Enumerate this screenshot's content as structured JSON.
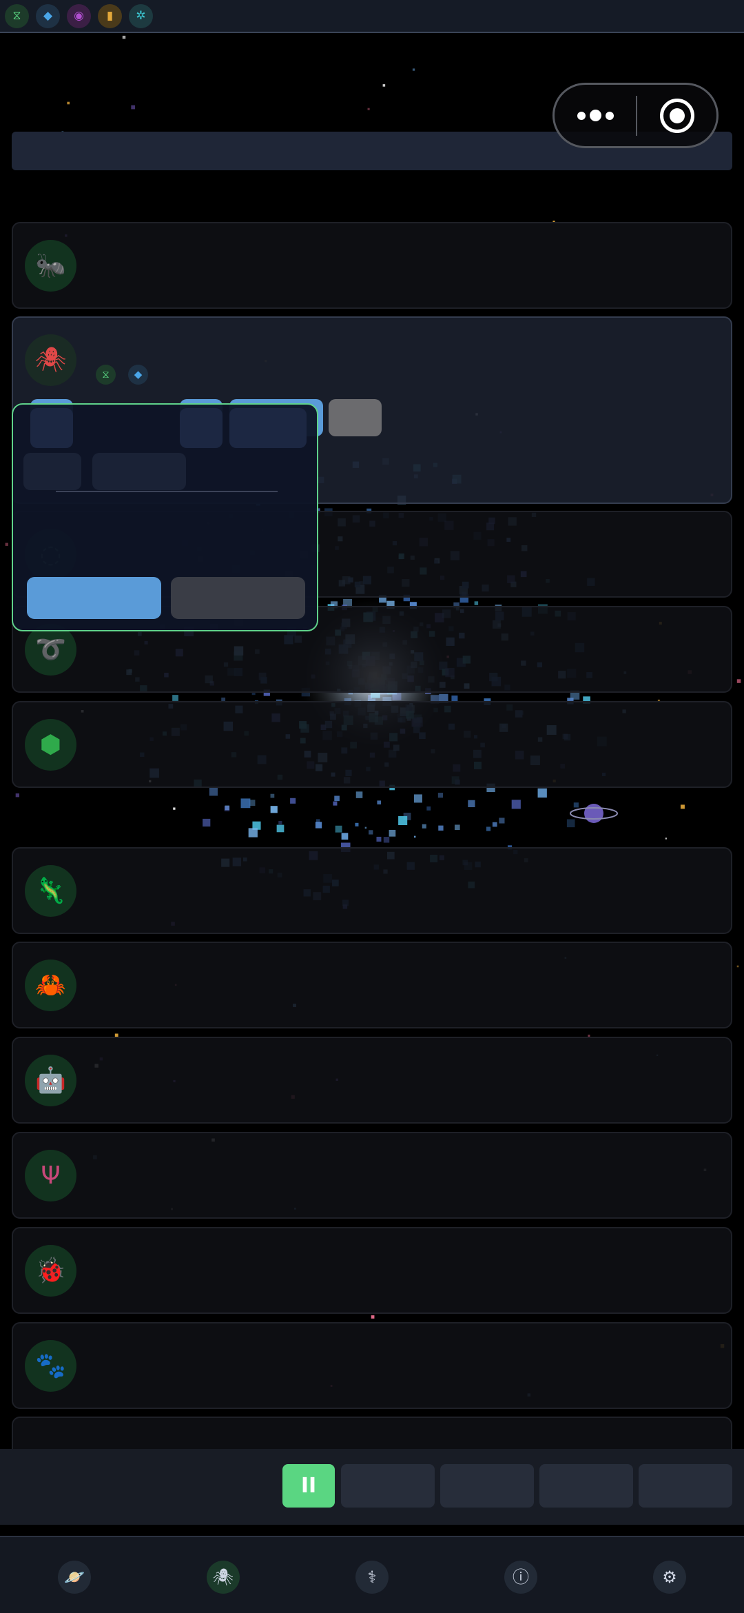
{
  "topbar": {
    "resources": [
      {
        "icon": "dna-icon",
        "glyph": "⧖",
        "bg": "#1d3b2a",
        "color": "#5ad682"
      },
      {
        "icon": "gem-icon",
        "glyph": "◆",
        "bg": "#1e3144",
        "color": "#4aa6e8"
      },
      {
        "icon": "orb-icon",
        "glyph": "◉",
        "bg": "#3b1f45",
        "color": "#b14fd0"
      },
      {
        "icon": "energy-icon",
        "glyph": "▮",
        "bg": "#4a3a1a",
        "color": "#e3a83a"
      },
      {
        "icon": "gear-icon",
        "glyph": "✲",
        "bg": "#1d3a40",
        "color": "#3cc7d2"
      }
    ]
  },
  "creatures": [
    {
      "name": "ant-icon",
      "glyph": "🐜",
      "color": "#3fb85f"
    },
    {
      "name": "spider-icon",
      "glyph": "🕷",
      "color": "#e04848"
    },
    {
      "name": "creature-3-icon",
      "glyph": "◌",
      "color": "#3f8f6a"
    },
    {
      "name": "ring-creature-icon",
      "glyph": "➰",
      "color": "#b6c23a"
    },
    {
      "name": "hexagon-icon",
      "glyph": "⬢",
      "color": "#2faa4b"
    },
    {
      "name": "lizard-icon",
      "glyph": "🦎",
      "color": "#5a7ad8"
    },
    {
      "name": "crab-icon",
      "glyph": "🦀",
      "color": "#a25a4a"
    },
    {
      "name": "robot-icon",
      "glyph": "🤖",
      "color": "#4d63c8"
    },
    {
      "name": "antenna-icon",
      "glyph": "Ψ",
      "color": "#c8487a"
    },
    {
      "name": "beetle-icon",
      "glyph": "🐞",
      "color": "#b0a050"
    },
    {
      "name": "beast-icon",
      "glyph": "🐾",
      "color": "#a03a3a"
    }
  ],
  "expanded_card": {
    "badges": [
      {
        "icon": "dna-icon",
        "glyph": "⧖",
        "bg": "#1d3b2a",
        "color": "#5ad682"
      },
      {
        "icon": "gem-icon",
        "glyph": "◆",
        "bg": "#1e3144",
        "color": "#4aa6e8"
      }
    ]
  },
  "controls": {
    "pause_label": "II"
  },
  "nav": [
    {
      "icon": "planet-icon",
      "glyph": "🪐"
    },
    {
      "icon": "spider-nav-icon",
      "glyph": "🕷"
    },
    {
      "icon": "dna-nav-icon",
      "glyph": "⚕"
    },
    {
      "icon": "info-icon",
      "glyph": "ⓘ"
    },
    {
      "icon": "settings-icon",
      "glyph": "⚙"
    }
  ],
  "colors": {
    "accent_green": "#5ad682",
    "accent_blue": "#5a9bd8",
    "popup_border": "#5fd28a"
  }
}
